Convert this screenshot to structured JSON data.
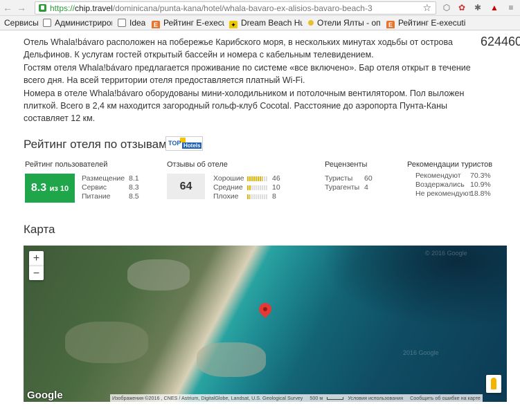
{
  "browser": {
    "url_scheme": "https://",
    "url_host": "chip.travel",
    "url_path": "/dominicana/punta-kana/hotel/whala-bavaro-ex-alisios-bavaro-beach-3",
    "bookmarks": [
      {
        "label": "Сервисы",
        "icon": "apps"
      },
      {
        "label": "Администрирова",
        "icon": "doc"
      },
      {
        "label": "Idea",
        "icon": "doc"
      },
      {
        "label": "Рейтинг E-executi",
        "icon": "e"
      },
      {
        "label": "Dream Beach Hut",
        "icon": "dream"
      },
      {
        "label": "Отели Ялты - опи",
        "icon": "dot"
      },
      {
        "label": "Рейтинг E-executi",
        "icon": "e"
      }
    ]
  },
  "hotel": {
    "side_number": "624460",
    "description": [
      "Отель Whala!bávaro расположен на побережье Карибского моря, в нескольких минутах ходьбы от острова Дельфинов. К услугам гостей открытый бассейн и номера с кабельным телевидением.",
      "Гостям отеля Whala!bávaro предлагается проживание по системе «все включено». Бар отеля открыт в течение всего дня. На всей территории отеля предоставляется платный Wi-Fi.",
      "Номера в отеле Whala!bávaro оборудованы мини-холодильником и потолочным вентилятором. Пол выложен плиткой. Всего в 2,4 км находится загородный гольф-клуб Cocotal. Расстояние до аэропорта Пунта-Каны составляет 12 км."
    ]
  },
  "rating": {
    "title": "Рейтинг отеля по отзывам",
    "logo_top": "TOP",
    "logo_hotels": "Hotels",
    "user_rating": {
      "label": "Рейтинг пользователей",
      "score": "8.3",
      "score_suffix": "из 10",
      "items": [
        {
          "label": "Размещение",
          "value": "8.1"
        },
        {
          "label": "Сервис",
          "value": "8.3"
        },
        {
          "label": "Питание",
          "value": "8.5"
        }
      ]
    },
    "reviews": {
      "label": "Отзывы об отеле",
      "total": "64",
      "items": [
        {
          "label": "Хорошие",
          "value": "46",
          "share": 0.72
        },
        {
          "label": "Средние",
          "value": "10",
          "share": 0.16
        },
        {
          "label": "Плохие",
          "value": "8",
          "share": 0.12
        }
      ]
    },
    "reviewers": {
      "label": "Рецензенты",
      "items": [
        {
          "label": "Туристы",
          "value": "60"
        },
        {
          "label": "Турагенты",
          "value": "4"
        }
      ]
    },
    "recommendations": {
      "label": "Рекомендации туристов",
      "items": [
        {
          "label": "Рекомендуют",
          "value": "70.3%"
        },
        {
          "label": "Воздержались",
          "value": "10.9%"
        },
        {
          "label": "Не рекомендуют",
          "value": "18.8%"
        }
      ]
    }
  },
  "map": {
    "title": "Карта",
    "zoom_in": "+",
    "zoom_out": "−",
    "google": "Google",
    "attribution": "Изображения ©2016 , CNES / Astrium, DigitalGlobe, Landsat, U.S. Geological Survey",
    "scale": "500 м",
    "terms": "Условия использования",
    "report": "Сообщить об ошибке на карте",
    "watermark_1": "© 2016 Google",
    "watermark_2": "2016 Google"
  },
  "colors": {
    "score_green": "#1fa64a",
    "bar_gold": "#e0b400",
    "pin_red": "#e53935"
  }
}
